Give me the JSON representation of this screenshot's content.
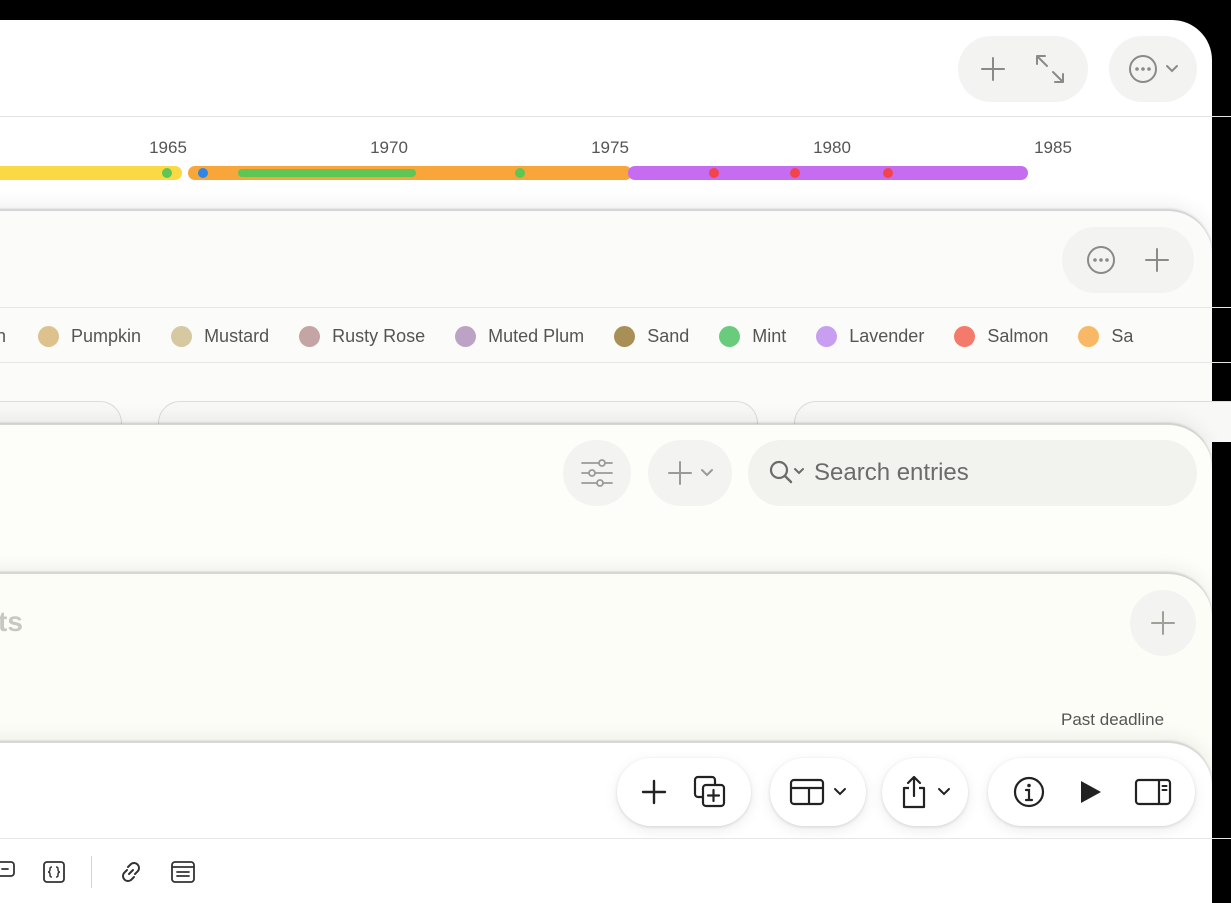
{
  "timeline": {
    "years": [
      "1965",
      "1970",
      "1975",
      "1980",
      "1985"
    ]
  },
  "legend": {
    "items": [
      {
        "label": "en",
        "color": "#d7b874"
      },
      {
        "label": "Pumpkin",
        "color": "#ddc28e"
      },
      {
        "label": "Mustard",
        "color": "#d6c8a0"
      },
      {
        "label": "Rusty Rose",
        "color": "#c4a4a4"
      },
      {
        "label": "Muted Plum",
        "color": "#bca3c6"
      },
      {
        "label": "Sand",
        "color": "#a88f55"
      },
      {
        "label": "Mint",
        "color": "#69cc7d"
      },
      {
        "label": "Lavender",
        "color": "#c79ef0"
      },
      {
        "label": "Salmon",
        "color": "#f47a6c"
      },
      {
        "label": "Sa",
        "color": "#f8b866"
      }
    ]
  },
  "entries": {
    "search_placeholder": "Search entries"
  },
  "projects": {
    "title_partial": "ts",
    "status_label": "Past deadline"
  },
  "colors": {
    "yellow": "#fbd944",
    "orange": "#f8a53a",
    "purple": "#c66cf0",
    "green": "#5ec655",
    "blue": "#2f86e8",
    "red": "#f2444a"
  }
}
